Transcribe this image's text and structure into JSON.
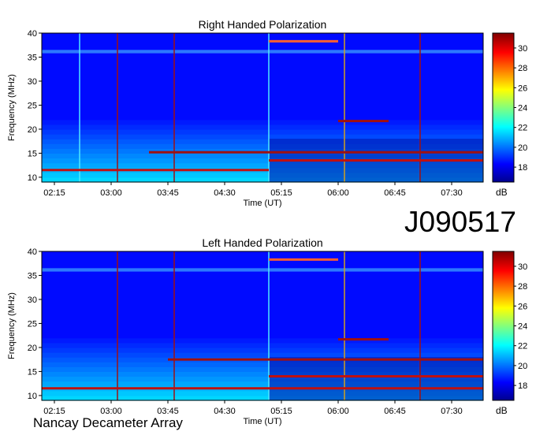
{
  "observation_id": "J090517",
  "footer": "Nancay Decameter Array",
  "colorbar": {
    "unit": "dB",
    "range": [
      16.5,
      31.5
    ],
    "ticks": [
      "18",
      "20",
      "22",
      "24",
      "26",
      "28",
      "30"
    ],
    "colormap": [
      "#00008f",
      "#0000ff",
      "#00ffff",
      "#ffff00",
      "#ff0000",
      "#800000"
    ]
  },
  "chart_data": [
    {
      "type": "heatmap",
      "title": "Right Handed Polarization",
      "xlabel": "Time (UT)",
      "ylabel": "Frequency (MHz)",
      "x_ticks": [
        "02:15",
        "03:00",
        "03:45",
        "04:30",
        "05:15",
        "06:00",
        "06:45",
        "07:30"
      ],
      "y_ticks": [
        "10",
        "15",
        "20",
        "25",
        "30",
        "35",
        "40"
      ],
      "xlim": [
        "02:05",
        "07:55"
      ],
      "ylim": [
        9,
        40
      ],
      "color_unit": "dB",
      "features": [
        {
          "kind": "vertical-line",
          "time": "02:35",
          "color": "#4fe8ff"
        },
        {
          "kind": "vertical-line",
          "time": "03:05",
          "color": "#a01010"
        },
        {
          "kind": "vertical-line",
          "time": "03:50",
          "color": "#a01010"
        },
        {
          "kind": "vertical-line",
          "time": "05:05",
          "color": "#4fe8ff"
        },
        {
          "kind": "vertical-line",
          "time": "06:05",
          "color": "#d0a020"
        },
        {
          "kind": "vertical-line",
          "time": "07:05",
          "color": "#a01010"
        },
        {
          "kind": "horizontal-band",
          "t0": "05:05",
          "t1": "06:00",
          "freq": 38.3,
          "color": "#ff6030"
        },
        {
          "kind": "horizontal-band",
          "t0": "06:00",
          "t1": "06:40",
          "freq": 21.7,
          "color": "#a01010"
        },
        {
          "kind": "horizontal-band",
          "t0": "03:30",
          "t1": "07:55",
          "freq": 15.2,
          "color": "#a01010"
        },
        {
          "kind": "horizontal-band",
          "t0": "05:05",
          "t1": "07:55",
          "freq": 13.5,
          "color": "#c01010"
        },
        {
          "kind": "horizontal-band",
          "t0": "02:05",
          "t1": "05:05",
          "freq": 11.5,
          "color": "#c01010"
        }
      ]
    },
    {
      "type": "heatmap",
      "title": "Left Handed Polarization",
      "xlabel": "Time (UT)",
      "ylabel": "Frequency (MHz)",
      "x_ticks": [
        "02:15",
        "03:00",
        "03:45",
        "04:30",
        "05:15",
        "06:00",
        "06:45",
        "07:30"
      ],
      "y_ticks": [
        "10",
        "15",
        "20",
        "25",
        "30",
        "35",
        "40"
      ],
      "xlim": [
        "02:05",
        "07:55"
      ],
      "ylim": [
        9,
        40
      ],
      "color_unit": "dB",
      "features": [
        {
          "kind": "vertical-line",
          "time": "03:05",
          "color": "#a01010"
        },
        {
          "kind": "vertical-line",
          "time": "03:50",
          "color": "#a01010"
        },
        {
          "kind": "vertical-line",
          "time": "05:05",
          "color": "#4fe8ff"
        },
        {
          "kind": "vertical-line",
          "time": "06:05",
          "color": "#d0a020"
        },
        {
          "kind": "vertical-line",
          "time": "07:05",
          "color": "#a01010"
        },
        {
          "kind": "horizontal-band",
          "t0": "05:05",
          "t1": "06:00",
          "freq": 38.3,
          "color": "#ff6030"
        },
        {
          "kind": "horizontal-band",
          "t0": "06:00",
          "t1": "06:40",
          "freq": 21.7,
          "color": "#a01010"
        },
        {
          "kind": "horizontal-band",
          "t0": "03:45",
          "t1": "07:55",
          "freq": 17.5,
          "color": "#a01010"
        },
        {
          "kind": "horizontal-band",
          "t0": "05:05",
          "t1": "07:55",
          "freq": 14.0,
          "color": "#c01010"
        },
        {
          "kind": "horizontal-band",
          "t0": "02:05",
          "t1": "07:55",
          "freq": 11.5,
          "color": "#c01010"
        }
      ]
    }
  ]
}
